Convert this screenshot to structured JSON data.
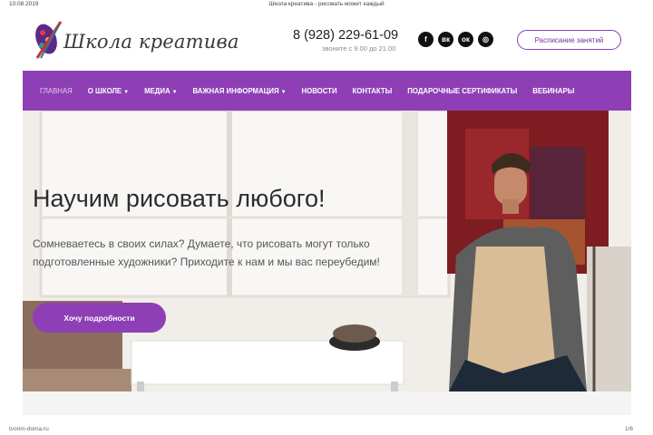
{
  "print_header": {
    "date": "10.08.2019",
    "title": "Школа креатива - рисовать может каждый"
  },
  "header": {
    "logo_text": "Школа креатива",
    "phone": "8 (928) 229-61-09",
    "hours": "звоните с 9.00 до 21.00",
    "socials": [
      {
        "icon": "facebook-icon",
        "glyph": "f"
      },
      {
        "icon": "vk-icon",
        "glyph": "вк"
      },
      {
        "icon": "odnoklassniki-icon",
        "glyph": "ок"
      },
      {
        "icon": "instagram-icon",
        "glyph": "◎"
      }
    ],
    "schedule_label": "Расписание занятий"
  },
  "nav": {
    "items": [
      {
        "label": "ГЛАВНАЯ",
        "dropdown": false,
        "active": true
      },
      {
        "label": "О ШКОЛЕ",
        "dropdown": true
      },
      {
        "label": "МЕДИА",
        "dropdown": true
      },
      {
        "label": "ВАЖНАЯ ИНФОРМАЦИЯ",
        "dropdown": true
      },
      {
        "label": "НОВОСТИ",
        "dropdown": false
      },
      {
        "label": "КОНТАКТЫ",
        "dropdown": false
      },
      {
        "label": "ПОДАРОЧНЫЕ СЕРТИФИКАТЫ",
        "dropdown": false
      },
      {
        "label": "ВЕБИНАРЫ",
        "dropdown": false
      }
    ]
  },
  "hero": {
    "title": "Научим рисовать любого!",
    "text": "Сомневаетесь в своих силах? Думаете, что рисовать могут только подготовленные художники? Приходите к нам и мы вас переубедим!",
    "button_label": "Хочу подробности"
  },
  "print_footer": {
    "site": "tvorim-doma.ru",
    "pages": "1/6"
  },
  "colors": {
    "brand": "#8e3fb5",
    "nav_bg": "#8e3fb5"
  }
}
